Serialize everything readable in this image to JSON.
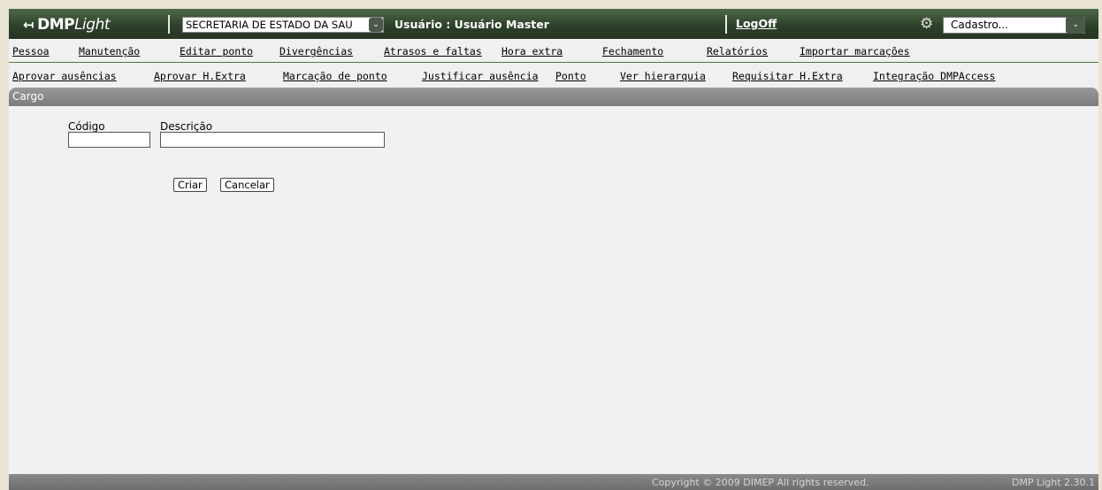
{
  "header": {
    "logo_bold": "DMP",
    "logo_light": "Light",
    "organization_select": "SECRETARIA DE ESTADO DA SAU",
    "user_label": "Usuário : Usuário Master",
    "logoff": "LogOff",
    "cadastro_select": "Cadastro..."
  },
  "menu_row1": [
    "Pessoa",
    "Manutenção",
    "Editar ponto",
    "Divergências",
    "Atrasos e faltas",
    "Hora extra",
    "Fechamento",
    "Relatórios",
    "Importar marcações"
  ],
  "menu_row2": [
    "Aprovar ausências",
    "Aprovar H.Extra",
    "Marcação de ponto",
    "Justificar ausência",
    "Ponto",
    "Ver hierarquia",
    "Requisitar H.Extra",
    "Integração DMPAccess"
  ],
  "panel": {
    "title": "Cargo",
    "codigo_label": "Código",
    "codigo_value": "",
    "descricao_label": "Descrição",
    "descricao_value": "",
    "criar": "Criar",
    "cancelar": "Cancelar"
  },
  "footer": {
    "copyright": "Copyright © 2009 DIMEP All rights reserved.",
    "version": "DMP Light 2.30.1"
  },
  "colors": {
    "header_green": "#2c3f29",
    "menu_border": "#4b7a3d",
    "panel_gray": "#7c7c7c"
  }
}
